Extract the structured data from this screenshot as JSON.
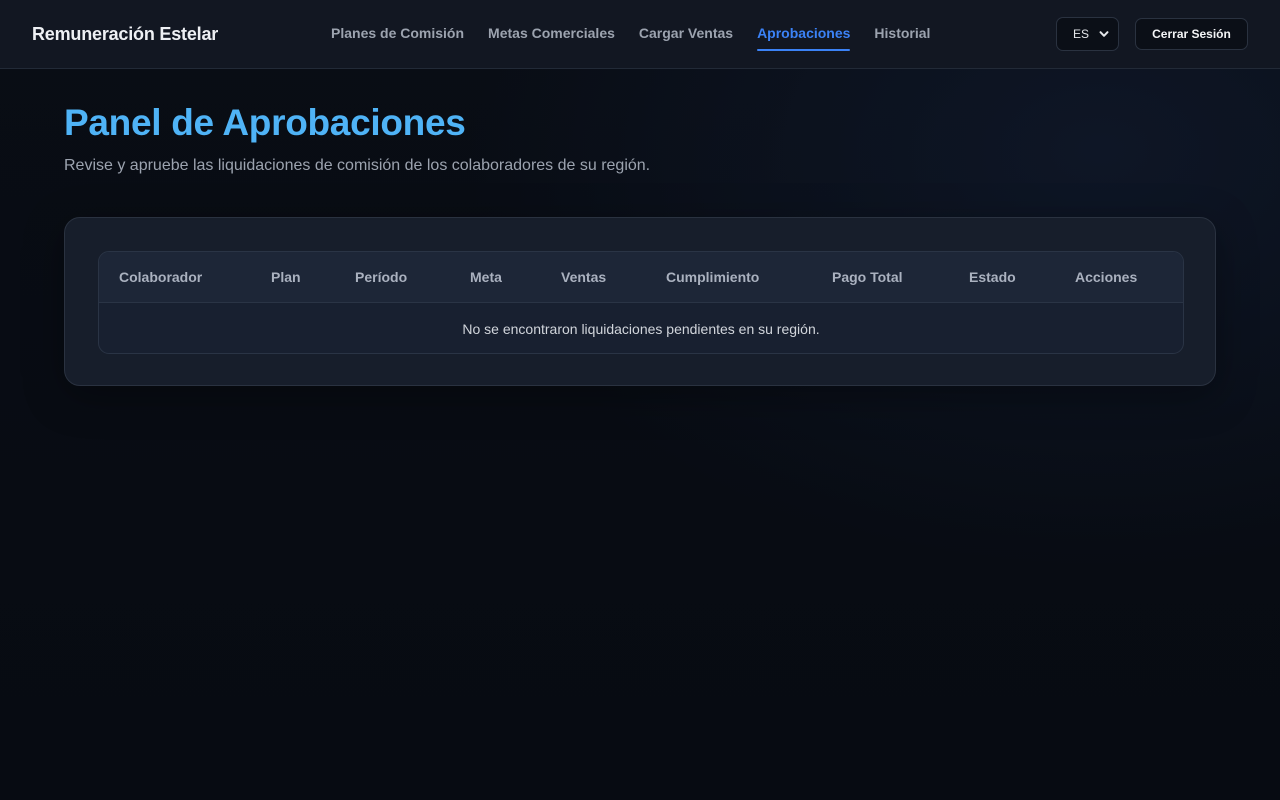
{
  "app": {
    "brand": "Remuneración Estelar"
  },
  "nav": {
    "items": [
      {
        "label": "Planes de Comisión",
        "active": false
      },
      {
        "label": "Metas Comerciales",
        "active": false
      },
      {
        "label": "Cargar Ventas",
        "active": false
      },
      {
        "label": "Aprobaciones",
        "active": true
      },
      {
        "label": "Historial",
        "active": false
      }
    ]
  },
  "header": {
    "language": {
      "selected": "ES",
      "icon": "chevron-down-icon"
    },
    "logout_label": "Cerrar Sesión"
  },
  "page": {
    "title": "Panel de Aprobaciones",
    "subtitle": "Revise y apruebe las liquidaciones de comisión de los colaboradores de su región."
  },
  "table": {
    "columns": [
      "Colaborador",
      "Plan",
      "Período",
      "Meta",
      "Ventas",
      "Cumplimiento",
      "Pago Total",
      "Estado",
      "Acciones"
    ],
    "rows": [],
    "empty_message": "No se encontraron liquidaciones pendientes en su región."
  },
  "colors": {
    "accent": "#3b82f6",
    "title": "#4fb3f6",
    "background": "#070b12",
    "card": "#171e2b"
  }
}
